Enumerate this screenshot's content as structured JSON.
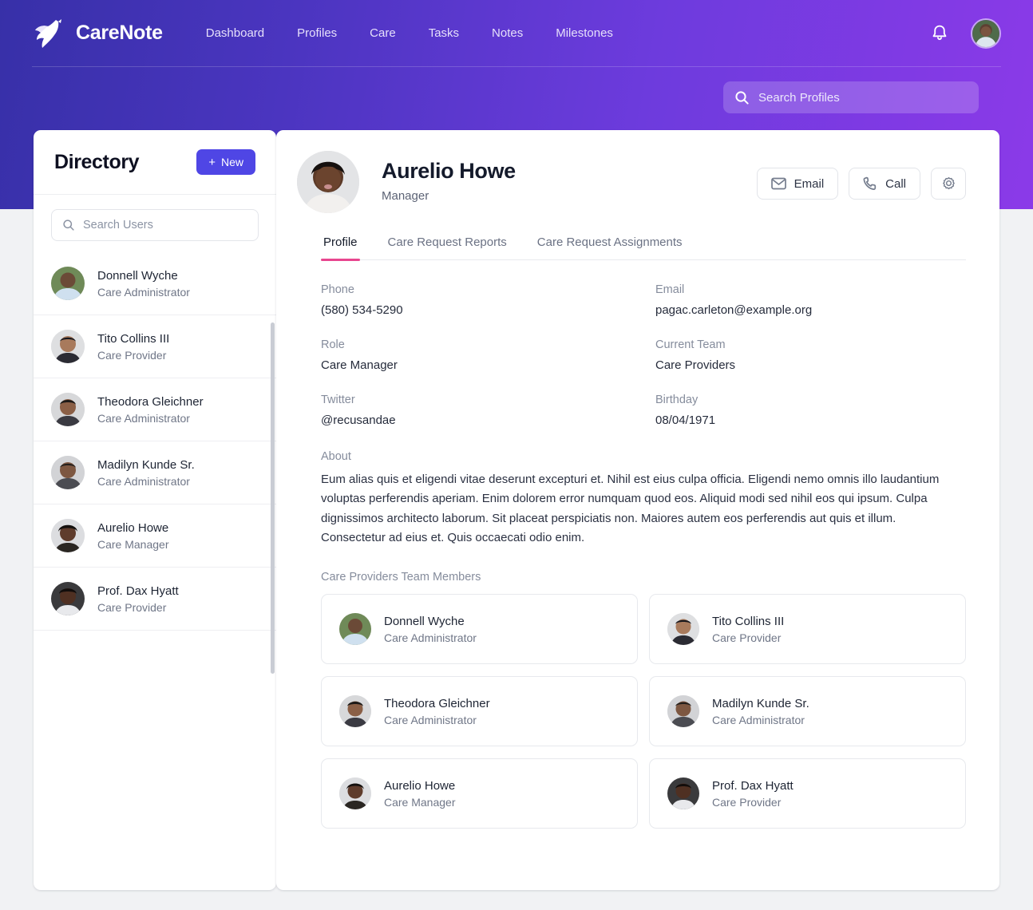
{
  "brand": {
    "name": "CareNote",
    "logo_icon": "dove-icon"
  },
  "nav": {
    "links": [
      {
        "label": "Dashboard"
      },
      {
        "label": "Profiles"
      },
      {
        "label": "Care"
      },
      {
        "label": "Tasks"
      },
      {
        "label": "Notes"
      },
      {
        "label": "Milestones"
      }
    ],
    "bell_icon": "bell-icon",
    "avatar_icon": "user-avatar"
  },
  "global_search": {
    "placeholder": "Search Profiles",
    "value": "",
    "icon": "search-icon"
  },
  "sidebar": {
    "title": "Directory",
    "new_button": {
      "label": "New",
      "plus": "+"
    },
    "search": {
      "placeholder": "Search Users",
      "value": "",
      "icon": "search-icon"
    },
    "users": [
      {
        "name": "Donnell Wyche",
        "role": "Care Administrator"
      },
      {
        "name": "Tito Collins III",
        "role": "Care Provider"
      },
      {
        "name": "Theodora Gleichner",
        "role": "Care Administrator"
      },
      {
        "name": "Madilyn Kunde Sr.",
        "role": "Care Administrator"
      },
      {
        "name": "Aurelio Howe",
        "role": "Care Manager"
      },
      {
        "name": "Prof. Dax Hyatt",
        "role": "Care Provider"
      }
    ]
  },
  "profile": {
    "name": "Aurelio Howe",
    "subtitle": "Manager",
    "actions": {
      "email": {
        "label": "Email",
        "icon": "envelope-icon"
      },
      "call": {
        "label": "Call",
        "icon": "phone-icon"
      },
      "settings": {
        "icon": "gear-icon"
      }
    },
    "tabs": [
      {
        "label": "Profile",
        "active": true
      },
      {
        "label": "Care Request Reports",
        "active": false
      },
      {
        "label": "Care Request Assignments",
        "active": false
      }
    ],
    "fields": [
      {
        "label": "Phone",
        "value": "(580) 534-5290"
      },
      {
        "label": "Email",
        "value": "pagac.carleton@example.org"
      },
      {
        "label": "Role",
        "value": "Care Manager"
      },
      {
        "label": "Current Team",
        "value": "Care Providers"
      },
      {
        "label": "Twitter",
        "value": "@recusandae"
      },
      {
        "label": "Birthday",
        "value": "08/04/1971"
      }
    ],
    "about": {
      "label": "About",
      "text": "Eum alias quis et eligendi vitae deserunt excepturi et. Nihil est eius culpa officia. Eligendi nemo omnis illo laudantium voluptas perferendis aperiam. Enim dolorem error numquam quod eos. Aliquid modi sed nihil eos qui ipsum. Culpa dignissimos architecto laborum. Sit placeat perspiciatis non. Maiores autem eos perferendis aut quis et illum. Consectetur ad eius et. Quis occaecati odio enim."
    },
    "team": {
      "label": "Care Providers Team Members",
      "members": [
        {
          "name": "Donnell Wyche",
          "role": "Care Administrator"
        },
        {
          "name": "Tito Collins III",
          "role": "Care Provider"
        },
        {
          "name": "Theodora Gleichner",
          "role": "Care Administrator"
        },
        {
          "name": "Madilyn Kunde Sr.",
          "role": "Care Administrator"
        },
        {
          "name": "Aurelio Howe",
          "role": "Care Manager"
        },
        {
          "name": "Prof. Dax Hyatt",
          "role": "Care Provider"
        }
      ]
    }
  },
  "colors": {
    "header_gradient_start": "#3730a8",
    "header_gradient_end": "#8b3ae8",
    "primary_button": "#4f46e5",
    "active_tab_underline": "#e8468f",
    "page_background": "#f1f2f4"
  }
}
